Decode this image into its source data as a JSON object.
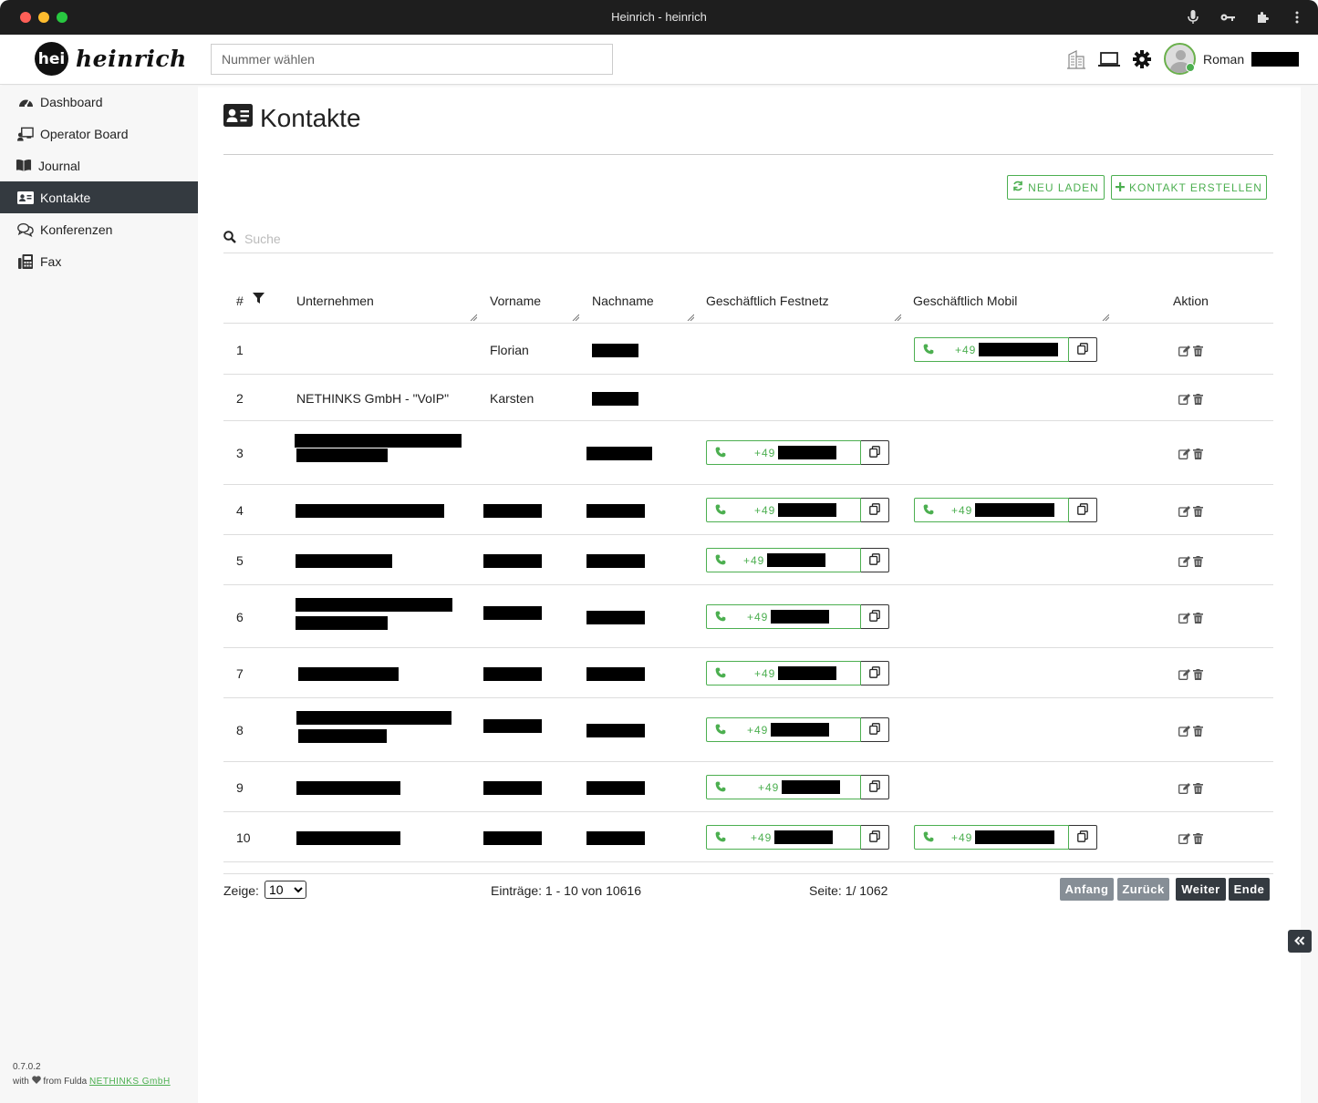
{
  "window": {
    "title": "Heinrich - heinrich"
  },
  "header": {
    "logo_mark": "hei",
    "logo_text": "heinrich",
    "dial_placeholder": "Nummer wählen",
    "user_first_name": "Roman"
  },
  "sidebar": {
    "items": [
      {
        "label": "Dashboard",
        "icon": "gauge-icon"
      },
      {
        "label": "Operator Board",
        "icon": "operator-board-icon"
      },
      {
        "label": "Journal",
        "icon": "book-icon"
      },
      {
        "label": "Kontakte",
        "icon": "address-card-icon",
        "active": true
      },
      {
        "label": "Konferenzen",
        "icon": "comments-icon"
      },
      {
        "label": "Fax",
        "icon": "fax-icon"
      }
    ],
    "version": "0.7.0.2",
    "footer_prefix": "with",
    "footer_middle": "from Fulda",
    "footer_link": "NETHINKS GmbH"
  },
  "main": {
    "title": "Kontakte",
    "reload_label": "NEU LADEN",
    "create_label": "KONTAKT ERSTELLEN",
    "search_placeholder": "Suche"
  },
  "table": {
    "columns": [
      "#",
      "Unternehmen",
      "Vorname",
      "Nachname",
      "Geschäftlich Festnetz",
      "Geschäftlich Mobil",
      "Aktion"
    ],
    "rows": [
      {
        "n": "1",
        "company": "",
        "first": "Florian",
        "fixed": "",
        "mobile": "+49"
      },
      {
        "n": "2",
        "company": "NETHINKS GmbH - \"VoIP\"",
        "first": "Karsten",
        "fixed": "",
        "mobile": ""
      },
      {
        "n": "3",
        "company": "",
        "first": "",
        "fixed": "+49",
        "mobile": ""
      },
      {
        "n": "4",
        "company": "",
        "first": "",
        "fixed": "+49",
        "mobile": "+49"
      },
      {
        "n": "5",
        "company": "",
        "first": "",
        "fixed": "+49",
        "mobile": ""
      },
      {
        "n": "6",
        "company": "",
        "first": "",
        "fixed": "+49",
        "mobile": ""
      },
      {
        "n": "7",
        "company": "",
        "first": "",
        "fixed": "+49",
        "mobile": ""
      },
      {
        "n": "8",
        "company": "",
        "first": "",
        "fixed": "+49",
        "mobile": ""
      },
      {
        "n": "9",
        "company": "",
        "first": "",
        "fixed": "+49",
        "mobile": ""
      },
      {
        "n": "10",
        "company": "",
        "first": "",
        "fixed": "+49",
        "mobile": "+49"
      }
    ]
  },
  "pager": {
    "show_label": "Zeige:",
    "page_size": "10",
    "entries": "Einträge: 1 - 10 von 10616",
    "page": "Seite: 1/ 1062",
    "first": "Anfang",
    "back": "Zurück",
    "next": "Weiter",
    "end": "Ende"
  },
  "colors": {
    "accent": "#4caf50",
    "dark": "#343a40",
    "disabled": "#868e96"
  }
}
